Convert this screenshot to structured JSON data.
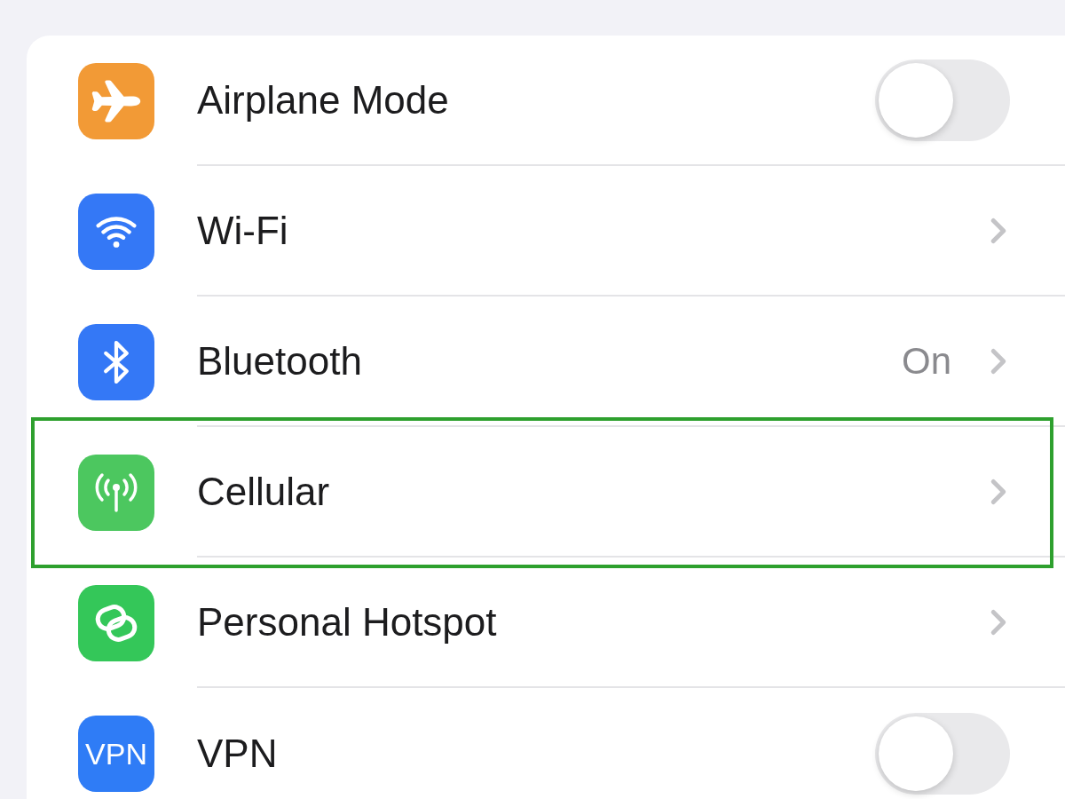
{
  "settings": [
    {
      "kind": "toggle",
      "label": "Airplane Mode",
      "color": "#f29a36",
      "on": false,
      "highlighted": false
    },
    {
      "kind": "link",
      "label": "Wi-Fi",
      "color": "#3478f6",
      "highlighted": false
    },
    {
      "kind": "link",
      "label": "Bluetooth",
      "color": "#3478f6",
      "value": "On",
      "highlighted": false
    },
    {
      "kind": "link",
      "label": "Cellular",
      "color": "#4cc75f",
      "highlighted": true
    },
    {
      "kind": "link",
      "label": "Personal Hotspot",
      "color": "#34c759",
      "highlighted": false
    },
    {
      "kind": "toggle",
      "label": "VPN",
      "color": "#2f7cf6",
      "icon_text": "VPN",
      "on": false,
      "highlighted": false
    }
  ]
}
